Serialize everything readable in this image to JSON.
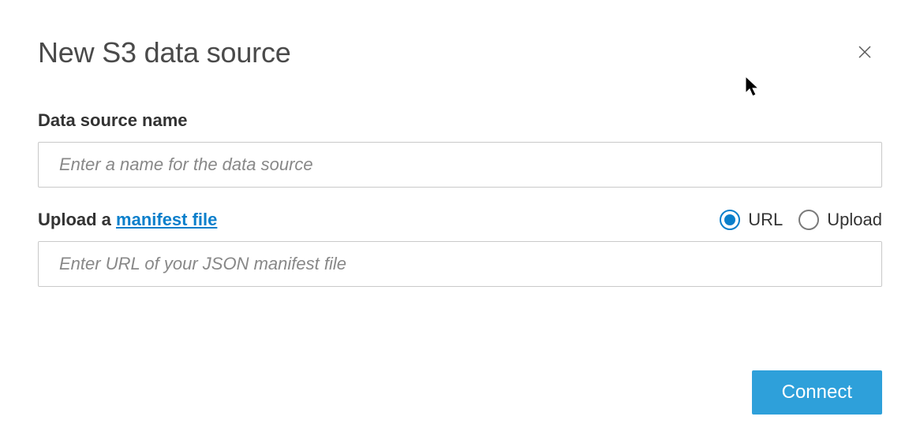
{
  "dialog": {
    "title": "New S3 data source"
  },
  "fields": {
    "name_label": "Data source name",
    "name_placeholder": "Enter a name for the data source",
    "name_value": "",
    "upload_prefix": "Upload a ",
    "manifest_link_text": "manifest file",
    "manifest_placeholder": "Enter URL of your JSON manifest file",
    "manifest_value": ""
  },
  "radios": {
    "url_label": "URL",
    "upload_label": "Upload",
    "selected": "url"
  },
  "buttons": {
    "connect": "Connect"
  }
}
